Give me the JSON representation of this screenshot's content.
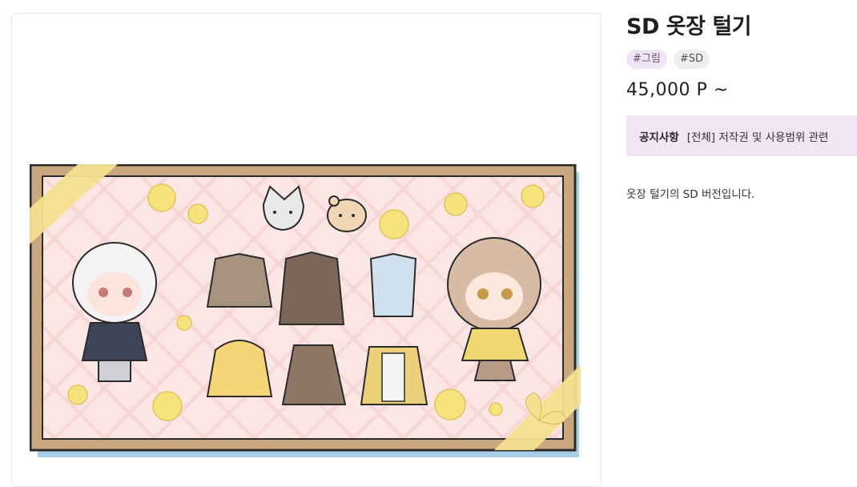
{
  "product": {
    "title": "SD 옷장 털기",
    "tags": [
      "#그림",
      "#SD"
    ],
    "price": "45,000 P ~",
    "notice": {
      "label": "공지사항",
      "text": "[전체] 저작권 및 사용범위 관련"
    },
    "description": "옷장 털기의 SD 버전입니다."
  },
  "illustration": {
    "colors": {
      "frame": "#c8a77f",
      "background": "#f7d3d3",
      "ribbon": "#f6df8f",
      "rose": "#f7e27c",
      "shadow": "#a9cfe6"
    },
    "items": [
      "white-haired-character",
      "brown-haired-character",
      "fox-mascot",
      "hamster-mascot",
      "beige-jacket",
      "brown-coat",
      "blue-shirt-set",
      "yellow-hoodie",
      "plaid-dress",
      "yellow-cardigan-set"
    ]
  }
}
